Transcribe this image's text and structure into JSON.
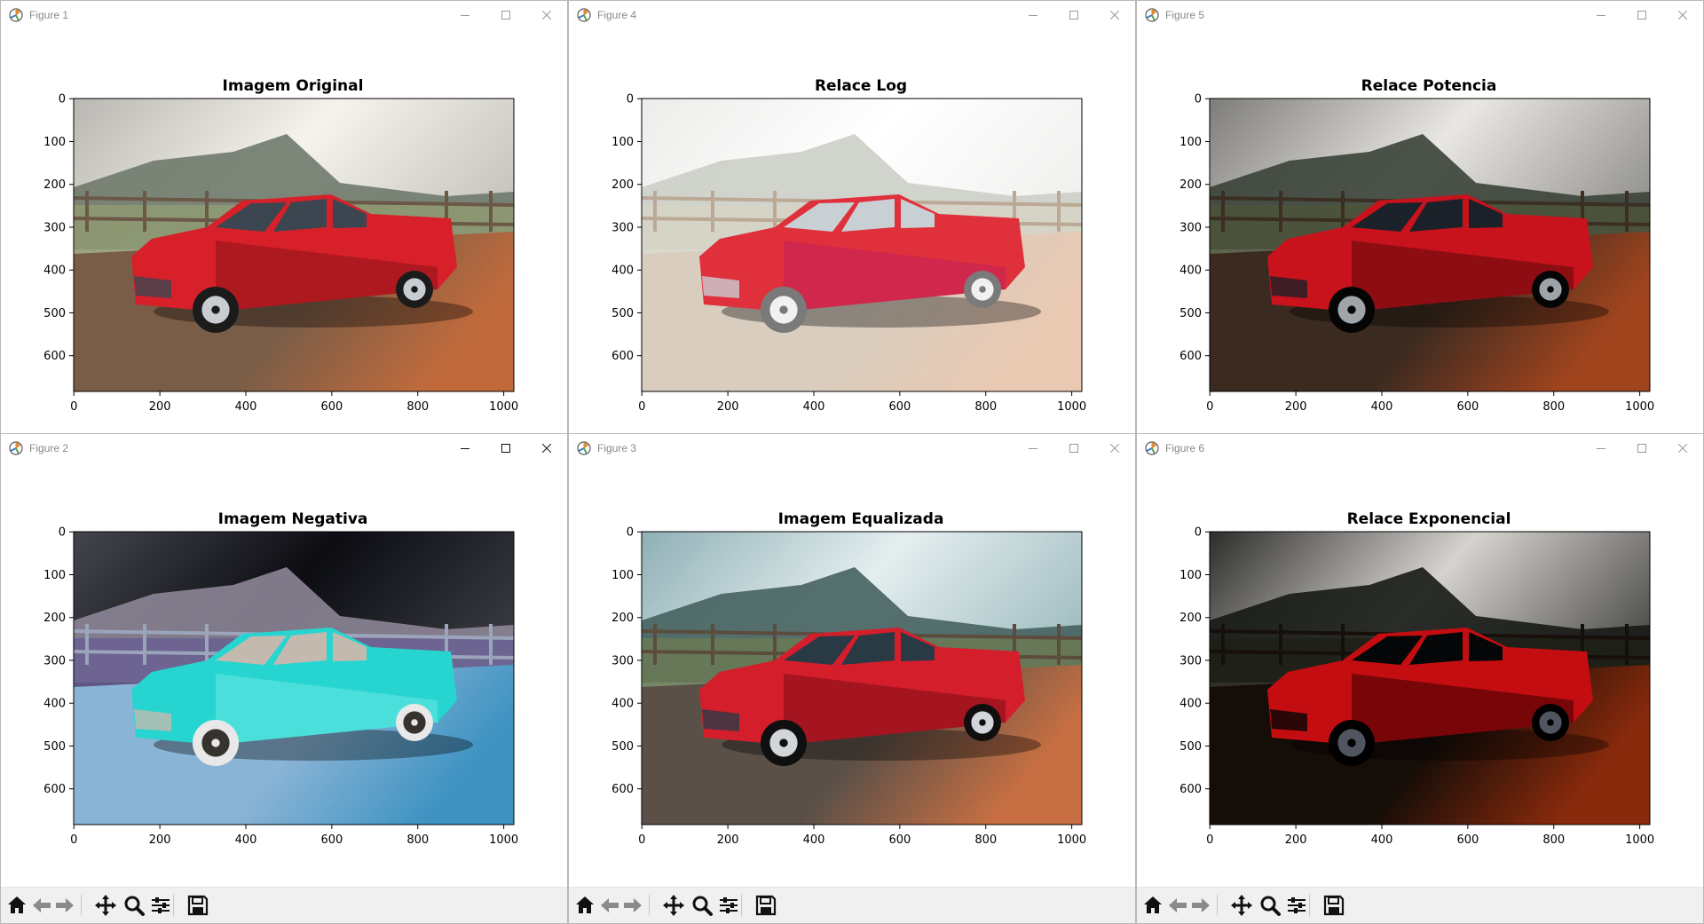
{
  "windows": [
    {
      "id": "fig1",
      "title": "Figure 1",
      "plot_title": "Imagem Original",
      "variant": "original",
      "active": false
    },
    {
      "id": "fig4",
      "title": "Figure 4",
      "plot_title": "Relace Log",
      "variant": "log",
      "active": false
    },
    {
      "id": "fig5",
      "title": "Figure 5",
      "plot_title": "Relace Potencia",
      "variant": "power",
      "active": false
    },
    {
      "id": "fig2",
      "title": "Figure 2",
      "plot_title": "Imagem Negativa",
      "variant": "negative",
      "active": true
    },
    {
      "id": "fig3",
      "title": "Figure 3",
      "plot_title": "Imagem Equalizada",
      "variant": "equalized",
      "active": false
    },
    {
      "id": "fig6",
      "title": "Figure 6",
      "plot_title": "Relace Exponencial",
      "variant": "exponential",
      "active": false
    }
  ],
  "axes": {
    "x_ticks": [
      "0",
      "200",
      "400",
      "600",
      "800",
      "1000"
    ],
    "y_ticks": [
      "0",
      "100",
      "200",
      "300",
      "400",
      "500",
      "600"
    ]
  },
  "icons": {
    "app": "matplotlib-figure-icon",
    "minimize": "minimize-icon",
    "maximize": "maximize-icon",
    "close": "close-icon",
    "toolbar": [
      "home-icon",
      "back-arrow-icon",
      "forward-arrow-icon",
      "pan-icon",
      "zoom-icon",
      "configure-subplots-icon",
      "save-icon"
    ]
  },
  "colors": {
    "window_background": "#ffffff",
    "toolbar_background": "#f0f0f0",
    "title_inactive": "#888888",
    "title_active": "#000000",
    "truck_red": "#d8202a",
    "truck_negative": "#27d5d0"
  }
}
